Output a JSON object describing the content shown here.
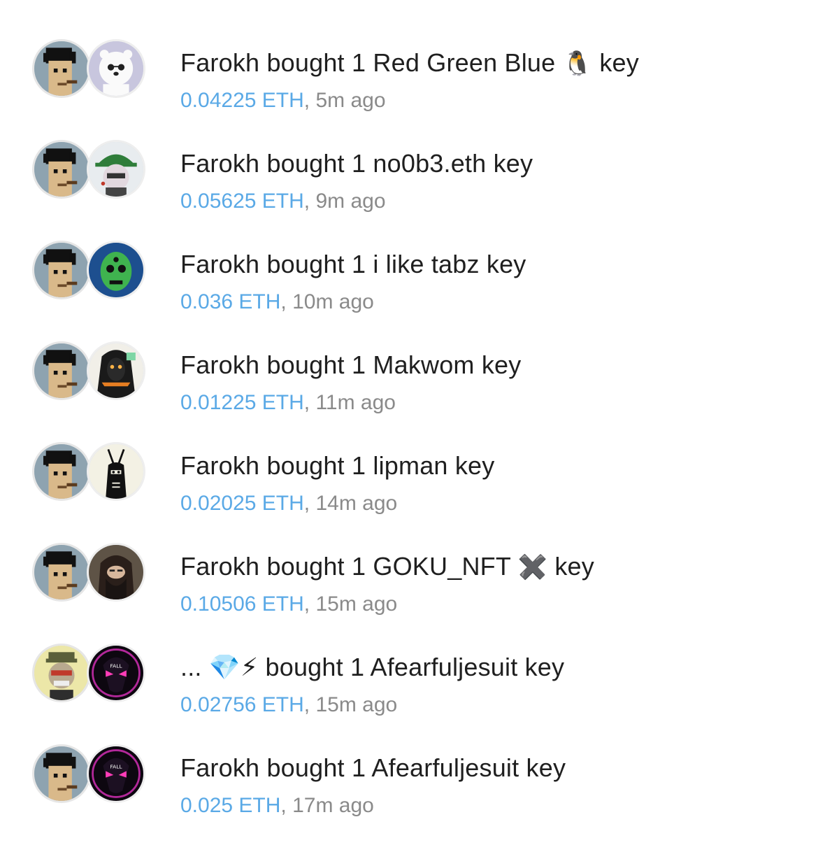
{
  "colors": {
    "text": "#1f1f1f",
    "price": "#5aa9e6",
    "time": "#8a8a8a",
    "background": "#ffffff"
  },
  "activity": [
    {
      "buyer": "Farokh",
      "verb": "bought",
      "quantity": "1",
      "subject": "Red Green Blue",
      "subject_emoji": "🐧",
      "suffix": "key",
      "price": "0.04225 ETH",
      "separator": ",",
      "time": "5m ago",
      "buyer_avatar": "punk-avatar",
      "subject_avatar": "polar-bear-avatar"
    },
    {
      "buyer": "Farokh",
      "verb": "bought",
      "quantity": "1",
      "subject": "no0b3.eth",
      "subject_emoji": "",
      "suffix": "key",
      "price": "0.05625 ETH",
      "separator": ",",
      "time": "9m ago",
      "buyer_avatar": "punk-avatar",
      "subject_avatar": "cap-character-avatar"
    },
    {
      "buyer": "Farokh",
      "verb": "bought",
      "quantity": "1",
      "subject": "i like tabz",
      "subject_emoji": "",
      "suffix": "key",
      "price": "0.036 ETH",
      "separator": ",",
      "time": "10m ago",
      "buyer_avatar": "punk-avatar",
      "subject_avatar": "green-skull-avatar"
    },
    {
      "buyer": "Farokh",
      "verb": "bought",
      "quantity": "1",
      "subject": "Makwom",
      "subject_emoji": "",
      "suffix": "key",
      "price": "0.01225 ETH",
      "separator": ",",
      "time": "11m ago",
      "buyer_avatar": "punk-avatar",
      "subject_avatar": "hooded-figure-avatar"
    },
    {
      "buyer": "Farokh",
      "verb": "bought",
      "quantity": "1",
      "subject": "lipman",
      "subject_emoji": "",
      "suffix": "key",
      "price": "0.02025 ETH",
      "separator": ",",
      "time": "14m ago",
      "buyer_avatar": "punk-avatar",
      "subject_avatar": "antenna-creature-avatar"
    },
    {
      "buyer": "Farokh",
      "verb": "bought",
      "quantity": "1",
      "subject": "GOKU_NFT",
      "subject_emoji": "✖️",
      "suffix": "key",
      "price": "0.10506 ETH",
      "separator": ",",
      "time": "15m ago",
      "buyer_avatar": "punk-avatar",
      "subject_avatar": "veiled-person-avatar"
    },
    {
      "buyer": "... 💎⚡",
      "verb": "bought",
      "quantity": "1",
      "subject": "Afearfuljesuit",
      "subject_emoji": "",
      "suffix": "key",
      "price": "0.02756 ETH",
      "separator": ",",
      "time": "15m ago",
      "buyer_avatar": "ape-avatar",
      "subject_avatar": "alien-avatar"
    },
    {
      "buyer": "Farokh",
      "verb": "bought",
      "quantity": "1",
      "subject": "Afearfuljesuit",
      "subject_emoji": "",
      "suffix": "key",
      "price": "0.025 ETH",
      "separator": ",",
      "time": "17m ago",
      "buyer_avatar": "punk-avatar",
      "subject_avatar": "alien-avatar"
    }
  ]
}
